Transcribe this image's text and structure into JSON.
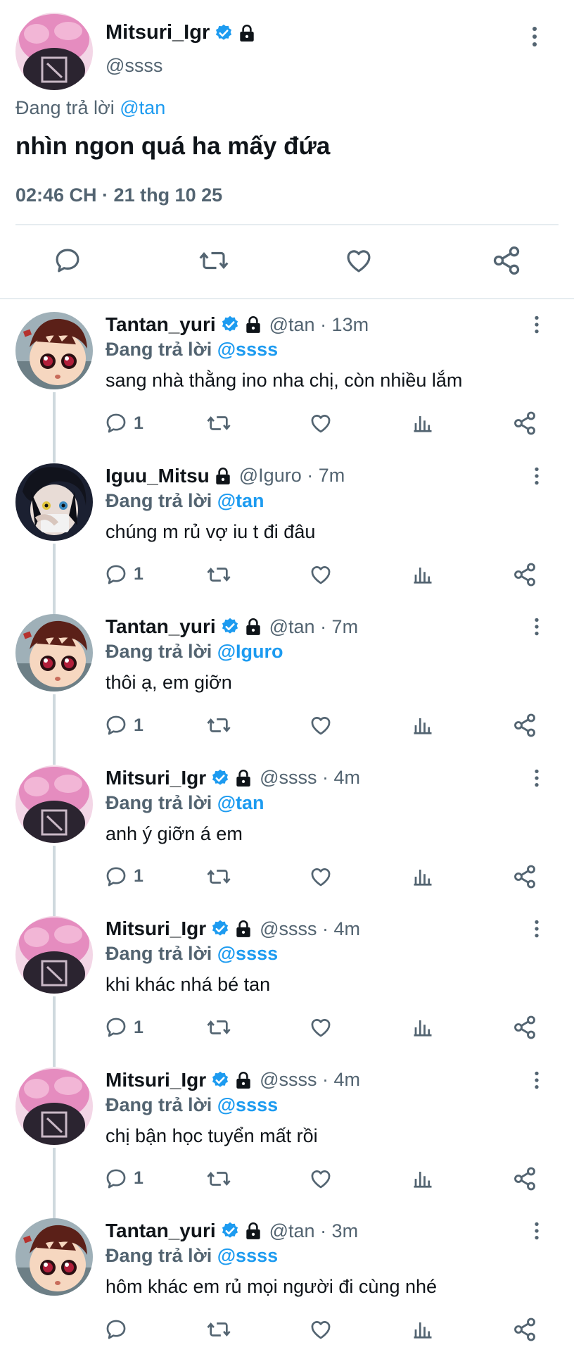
{
  "colors": {
    "accent": "#1d9bf0",
    "text": "#0f1419",
    "muted": "#536471",
    "divider": "#e6ecf0"
  },
  "main_tweet": {
    "display_name": "Mitsuri_Igr",
    "handle": "@ssss",
    "verified": true,
    "locked": true,
    "reply_prefix": "Đang trả lời ",
    "reply_to": "@tan",
    "text": "nhìn ngon quá ha mấy đứa",
    "timestamp": "02:46 CH · 21 thg 10 25",
    "actions": [
      "reply-icon",
      "retweet-icon",
      "like-icon",
      "share-icon"
    ]
  },
  "replies": [
    {
      "display_name": "Tantan_yuri",
      "verified": true,
      "meta": "@tan · 13m",
      "reply_prefix": "Đang trả lời ",
      "reply_to": "@ssss",
      "text": "sang nhà thằng ino nha chị, còn nhiều lắm",
      "reply_count": "1",
      "avatar": "tanjiro"
    },
    {
      "display_name": "Iguu_Mitsu",
      "verified": false,
      "meta": "@Iguro · 7m",
      "reply_prefix": "Đang trả lời ",
      "reply_to": "@tan",
      "text": "chúng m rủ vợ iu t đi đâu",
      "reply_count": "1",
      "avatar": "iguro"
    },
    {
      "display_name": "Tantan_yuri",
      "verified": true,
      "meta": "@tan · 7m",
      "reply_prefix": "Đang trả lời ",
      "reply_to": "@Iguro",
      "text": "thôi ạ, em giỡn",
      "reply_count": "1",
      "avatar": "tanjiro"
    },
    {
      "display_name": "Mitsuri_Igr",
      "verified": true,
      "meta": "@ssss · 4m",
      "reply_prefix": "Đang trả lời ",
      "reply_to": "@tan",
      "text": "anh ý giỡn á em",
      "reply_count": "1",
      "avatar": "mitsuri"
    },
    {
      "display_name": "Mitsuri_Igr",
      "verified": true,
      "meta": "@ssss · 4m",
      "reply_prefix": "Đang trả lời ",
      "reply_to": "@ssss",
      "text": "khi khác nhá bé tan",
      "reply_count": "1",
      "avatar": "mitsuri"
    },
    {
      "display_name": "Mitsuri_Igr",
      "verified": true,
      "meta": "@ssss · 4m",
      "reply_prefix": "Đang trả lời ",
      "reply_to": "@ssss",
      "text": "chị bận học tuyển mất rồi",
      "reply_count": "1",
      "avatar": "mitsuri"
    },
    {
      "display_name": "Tantan_yuri",
      "verified": true,
      "meta": "@tan · 3m",
      "reply_prefix": "Đang trả lời ",
      "reply_to": "@ssss",
      "text": "hôm khác em rủ mọi người đi cùng nhé",
      "reply_count": "",
      "avatar": "tanjiro"
    }
  ]
}
